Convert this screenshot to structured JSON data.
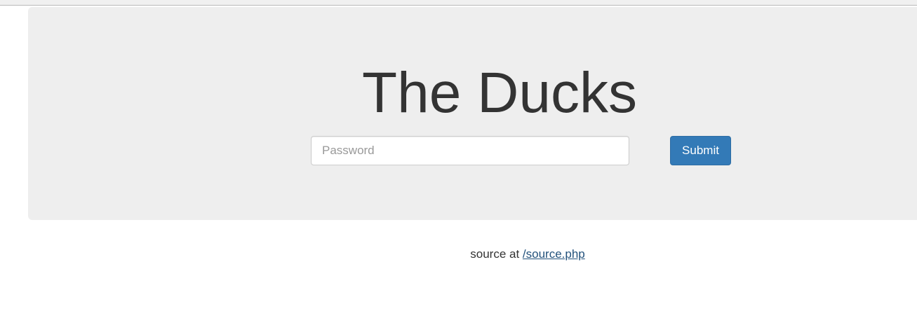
{
  "page": {
    "title": "The Ducks"
  },
  "form": {
    "password_placeholder": "Password",
    "submit_label": "Submit"
  },
  "footer": {
    "prefix": "source at ",
    "link_text": "/source.php"
  },
  "colors": {
    "jumbotron_bg": "#eeeeee",
    "button_primary": "#337ab7",
    "link": "#23527c",
    "text": "#333333"
  }
}
